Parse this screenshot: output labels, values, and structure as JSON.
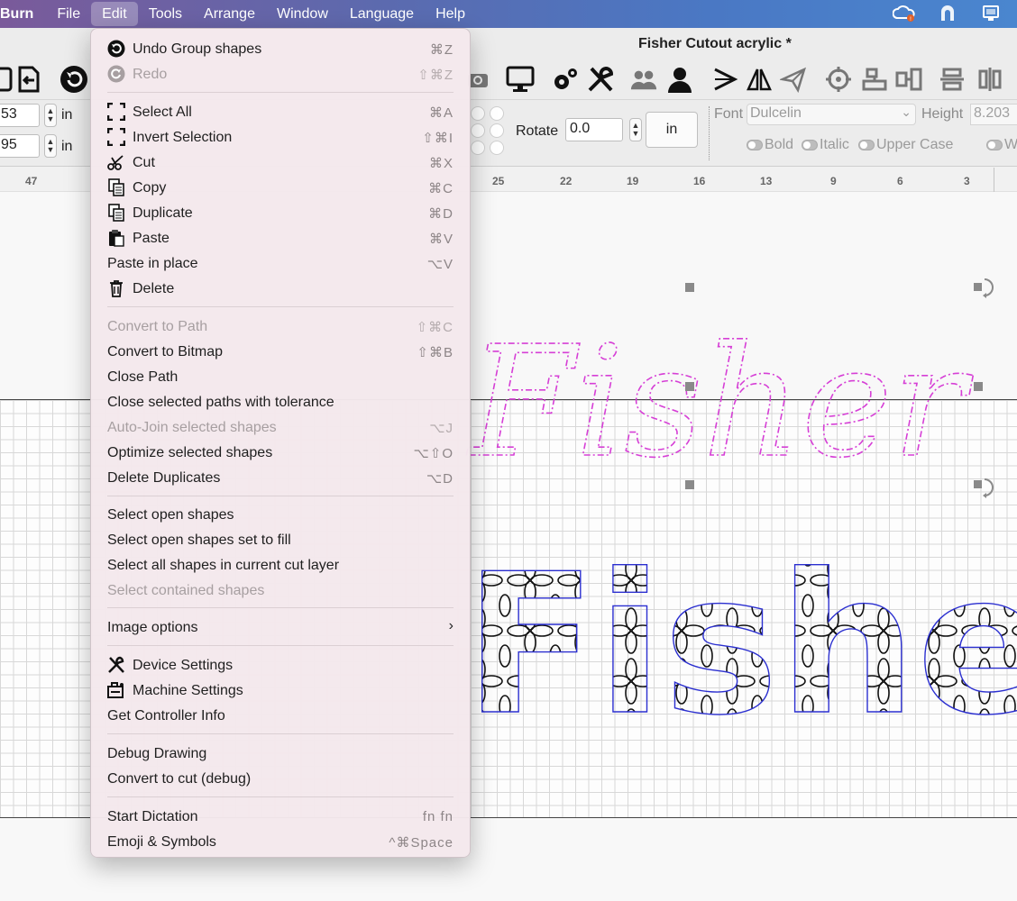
{
  "menubar": {
    "app": "Burn",
    "items": [
      "File",
      "Edit",
      "Tools",
      "Arrange",
      "Window",
      "Language",
      "Help"
    ],
    "active": "Edit",
    "tray_icons": [
      "creative-cloud-icon",
      "arch-icon",
      "monitor-icon"
    ]
  },
  "window": {
    "title": "Fisher Cutout acrylic *"
  },
  "props": {
    "x_value": "53",
    "y_value": "95",
    "unit_label": "in",
    "rotate_label": "Rotate",
    "rotate_value": "0.0",
    "unit_button": "in",
    "font_label": "Font",
    "font_value": "Dulcelin",
    "height_label": "Height",
    "height_value": "8.203",
    "toggles": [
      "Bold",
      "Italic",
      "Upper Case",
      "W"
    ]
  },
  "ruler": {
    "labels": [
      "47",
      "25",
      "22",
      "19",
      "16",
      "13",
      "9",
      "6",
      "3"
    ]
  },
  "canvas": {
    "upper_text": "Fisher",
    "lower_text": "Fisher",
    "upper_color": "#d63fd6",
    "lower_outline_color": "#2b2fd0"
  },
  "edit_menu": {
    "items": [
      {
        "label": "Undo Group shapes",
        "shortcut": "⌘Z",
        "icon": "undo-icon",
        "disabled": false
      },
      {
        "label": "Redo",
        "shortcut": "⇧⌘Z",
        "icon": "redo-icon",
        "disabled": true
      },
      {
        "label": "Select All",
        "shortcut": "⌘A",
        "icon": "select-all-icon",
        "disabled": false
      },
      {
        "label": "Invert Selection",
        "shortcut": "⇧⌘I",
        "icon": "invert-selection-icon",
        "disabled": false
      },
      {
        "label": "Cut",
        "shortcut": "⌘X",
        "icon": "scissors-icon",
        "disabled": false
      },
      {
        "label": "Copy",
        "shortcut": "⌘C",
        "icon": "copy-icon",
        "disabled": false
      },
      {
        "label": "Duplicate",
        "shortcut": "⌘D",
        "icon": "duplicate-icon",
        "disabled": false
      },
      {
        "label": "Paste",
        "shortcut": "⌘V",
        "icon": "clipboard-icon",
        "disabled": false
      },
      {
        "label": "Paste in place",
        "shortcut": "⌥V",
        "icon": "",
        "disabled": false
      },
      {
        "label": "Delete",
        "shortcut": "",
        "icon": "trash-icon",
        "disabled": false
      },
      {
        "label": "Convert to Path",
        "shortcut": "⇧⌘C",
        "icon": "",
        "disabled": true
      },
      {
        "label": "Convert to Bitmap",
        "shortcut": "⇧⌘B",
        "icon": "",
        "disabled": false
      },
      {
        "label": "Close Path",
        "shortcut": "",
        "icon": "",
        "disabled": false
      },
      {
        "label": "Close selected paths with tolerance",
        "shortcut": "",
        "icon": "",
        "disabled": false
      },
      {
        "label": "Auto-Join selected shapes",
        "shortcut": "⌥J",
        "icon": "",
        "disabled": true
      },
      {
        "label": "Optimize selected shapes",
        "shortcut": "⌥⇧O",
        "icon": "",
        "disabled": false
      },
      {
        "label": "Delete Duplicates",
        "shortcut": "⌥D",
        "icon": "",
        "disabled": false
      },
      {
        "label": "Select open shapes",
        "shortcut": "",
        "icon": "",
        "disabled": false
      },
      {
        "label": "Select open shapes set to fill",
        "shortcut": "",
        "icon": "",
        "disabled": false
      },
      {
        "label": "Select all shapes in current cut layer",
        "shortcut": "",
        "icon": "",
        "disabled": false
      },
      {
        "label": "Select contained shapes",
        "shortcut": "",
        "icon": "",
        "disabled": true
      },
      {
        "label": "Image options",
        "shortcut": "",
        "icon": "",
        "disabled": false,
        "submenu": "›"
      },
      {
        "label": "Device Settings",
        "shortcut": "",
        "icon": "wrench-screwdriver-icon",
        "disabled": false
      },
      {
        "label": "Machine Settings",
        "shortcut": "",
        "icon": "machine-settings-icon",
        "disabled": false
      },
      {
        "label": "Get Controller Info",
        "shortcut": "",
        "icon": "",
        "disabled": false
      },
      {
        "label": "Debug Drawing",
        "shortcut": "",
        "icon": "",
        "disabled": false
      },
      {
        "label": "Convert to cut (debug)",
        "shortcut": "",
        "icon": "",
        "disabled": false
      },
      {
        "label": "Start Dictation",
        "shortcut": "fn fn",
        "icon": "",
        "disabled": false
      },
      {
        "label": "Emoji & Symbols",
        "shortcut": "^⌘Space",
        "icon": "",
        "disabled": false
      }
    ]
  }
}
